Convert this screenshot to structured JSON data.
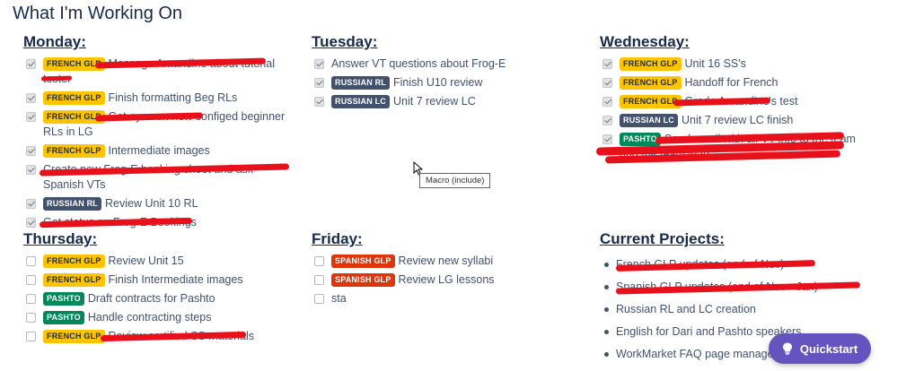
{
  "page_title": "What I'm Working On",
  "tooltip": "Macro (include)",
  "quickstart_label": "Quickstart",
  "icons": {
    "quickstart": "lightbulb-icon",
    "cursor": "mouse-pointer-icon"
  },
  "colors": {
    "french_glp": "#ffc400",
    "russian": "#42526e",
    "pashto": "#00875a",
    "spanish_glp": "#de350b",
    "redaction": "#e8101a",
    "quickstart": "#6554c0"
  },
  "monday": {
    "heading": "Monday:",
    "tasks": [
      {
        "badge": "FRENCH GLP",
        "text": "Message Amandine about tutorial tester",
        "checked": true,
        "redacted": true
      },
      {
        "badge": "FRENCH GLP",
        "text": "Finish formatting Beg RLs",
        "checked": true
      },
      {
        "badge": "FRENCH GLP",
        "text": "Get eyes on new configed beginner RLs in LG",
        "checked": true,
        "redacted": true
      },
      {
        "badge": "FRENCH GLP",
        "text": "Intermediate images",
        "checked": true
      },
      {
        "badge": "",
        "text": "Create new Frog-E booking sheet and ask Spanish VTs",
        "checked": true,
        "redacted": true
      },
      {
        "badge": "RUSSIAN RL",
        "text": "Review Unit 10 RL",
        "checked": true
      },
      {
        "badge": "",
        "text": "Get status on Frog-E Bookings",
        "checked": true,
        "redacted": true
      }
    ]
  },
  "tuesday": {
    "heading": "Tuesday:",
    "tasks": [
      {
        "badge": "",
        "text": "Answer VT questions about Frog-E",
        "checked": true
      },
      {
        "badge": "RUSSIAN RL",
        "text": "Finish U10 review",
        "checked": true
      },
      {
        "badge": "RUSSIAN LC",
        "text": "Unit 7 review LC",
        "checked": true
      }
    ]
  },
  "wednesday": {
    "heading": "Wednesday:",
    "tasks": [
      {
        "badge": "FRENCH GLP",
        "text": "Unit 16 SS's",
        "checked": true
      },
      {
        "badge": "FRENCH GLP",
        "text": "Handoff for French",
        "checked": true
      },
      {
        "badge": "FRENCH GLP",
        "text": "Grade Amandine's test",
        "checked": true,
        "redacted": true
      },
      {
        "badge": "RUSSIAN LC",
        "text": "Unit 7 review LC finish",
        "checked": true
      },
      {
        "badge": "PASHTO",
        "text": "Send email with all VT info to the team and the team lead",
        "checked": true,
        "redacted": true
      }
    ]
  },
  "thursday": {
    "heading": "Thursday:",
    "tasks": [
      {
        "badge": "FRENCH GLP",
        "text": "Review Unit 15",
        "checked": false
      },
      {
        "badge": "FRENCH GLP",
        "text": "Finish Intermediate images",
        "checked": false
      },
      {
        "badge": "PASHTO",
        "text": "Draft contracts for Pashto",
        "checked": false
      },
      {
        "badge": "PASHTO",
        "text": "Handle contracting steps",
        "checked": false
      },
      {
        "badge": "FRENCH GLP",
        "text": "Review certified SS materials",
        "checked": false,
        "redacted": true
      }
    ]
  },
  "friday": {
    "heading": "Friday:",
    "tasks": [
      {
        "badge": "SPANISH GLP",
        "text": "Review new syllabi",
        "checked": false
      },
      {
        "badge": "SPANISH GLP",
        "text": "Review LG lessons",
        "checked": false
      },
      {
        "badge": "",
        "text": "sta",
        "checked": false
      }
    ]
  },
  "projects": {
    "heading": "Current Projects:",
    "items": [
      "French GLP updates (end of Nov)",
      "Spanish GLP updates (end of Nov - Jan)",
      "Russian RL and LC creation",
      "English for Dari and Pashto speakers",
      "WorkMarket FAQ page manage"
    ]
  }
}
